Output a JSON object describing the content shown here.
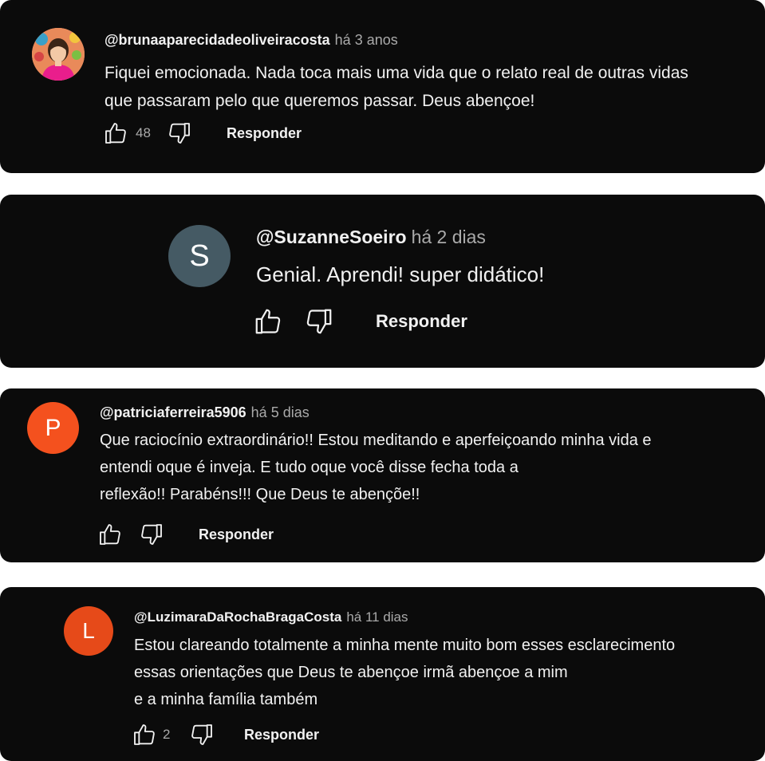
{
  "comments": [
    {
      "avatar_type": "photo",
      "avatar_letter": "",
      "handle": "@brunaaparecidadeoliveiracosta",
      "time": "há 3 anos",
      "lines": [
        "Fiquei emocionada. Nada toca mais uma vida que o relato real de outras vidas",
        "que passaram pelo que queremos passar. Deus abençoe!"
      ],
      "likes": "48",
      "reply_label": "Responder"
    },
    {
      "avatar_type": "letter",
      "avatar_letter": "S",
      "avatar_color": "#455a64",
      "handle": "@SuzanneSoeiro",
      "time": "há 2 dias",
      "lines": [
        "Genial. Aprendi! super didático!"
      ],
      "likes": "",
      "reply_label": "Responder"
    },
    {
      "avatar_type": "letter",
      "avatar_letter": "P",
      "avatar_color": "#f4511e",
      "handle": "@patriciaferreira5906",
      "time": "há 5 dias",
      "lines": [
        "Que raciocínio extraordinário!! Estou meditando e aperfeiçoando minha vida e",
        "entendi oque é inveja. E tudo oque você disse fecha toda a",
        "reflexão!! Parabéns!!! Que Deus te abençõe!!"
      ],
      "likes": "",
      "reply_label": "Responder"
    },
    {
      "avatar_type": "letter",
      "avatar_letter": "L",
      "avatar_color": "#e64a19",
      "handle": "@LuzimaraDaRochaBragaCosta",
      "time": "há 11 dias",
      "lines": [
        "Estou clareando totalmente a minha mente muito bom esses esclarecimento",
        "essas orientações que Deus te abençoe irmã abençoe a mim",
        "e a minha família também"
      ],
      "likes": "2",
      "reply_label": "Responder"
    }
  ],
  "icons": {
    "like": "thumbs-up-icon",
    "dislike": "thumbs-down-icon"
  },
  "colors": {
    "card_background": "#0b0b0b",
    "text": "#f1f1f1",
    "secondary_text": "#aaaaaa"
  }
}
